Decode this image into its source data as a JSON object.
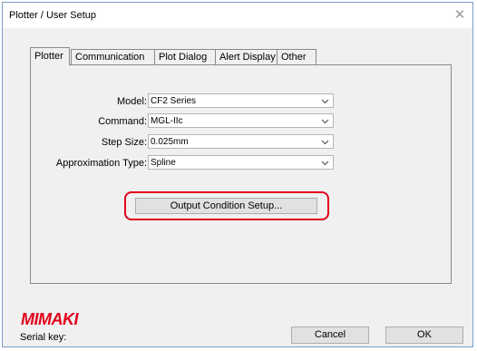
{
  "window": {
    "title": "Plotter / User Setup",
    "close_glyph": "✕"
  },
  "tabs": [
    {
      "label": "Plotter",
      "active": true
    },
    {
      "label": "Communication",
      "active": false
    },
    {
      "label": "Plot Dialog",
      "active": false
    },
    {
      "label": "Alert Display",
      "active": false
    },
    {
      "label": "Other",
      "active": false
    }
  ],
  "fields": {
    "model": {
      "label": "Model:",
      "value": "CF2 Series"
    },
    "command": {
      "label": "Command:",
      "value": "MGL-IIc"
    },
    "step_size": {
      "label": "Step Size:",
      "value": "0.025mm"
    },
    "approximation_type": {
      "label": "Approximation Type:",
      "value": "Spline"
    }
  },
  "output_condition_button": "Output Condition Setup...",
  "brand": {
    "name": "MIMAKI",
    "color": "#e2001a"
  },
  "highlight_color": "#e2001a",
  "serial_key_label": "Serial key:",
  "buttons": {
    "cancel": "Cancel",
    "ok": "OK"
  }
}
